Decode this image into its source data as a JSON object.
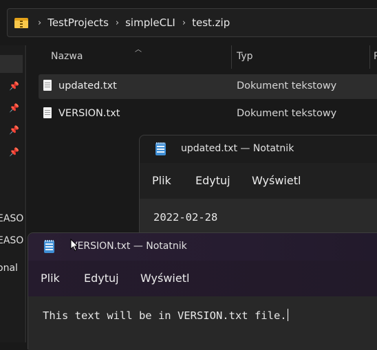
{
  "address_bar": {
    "crumbs": [
      "TestProjects",
      "simpleCLI",
      "test.zip"
    ]
  },
  "columns": {
    "name": "Nazwa",
    "type": "Typ",
    "extra": "R"
  },
  "files": [
    {
      "name": "updated.txt",
      "type": "Dokument tekstowy"
    },
    {
      "name": "VERSION.txt",
      "type": "Dokument tekstowy"
    }
  ],
  "sidebar": {
    "labels": [
      "EASO",
      "EASO",
      "onal"
    ]
  },
  "notepad_back": {
    "title": "updated.txt — Notatnik",
    "menu": [
      "Plik",
      "Edytuj",
      "Wyświetl"
    ],
    "content": "2022-02-28"
  },
  "notepad_front": {
    "title": "VERSION.txt — Notatnik",
    "menu": [
      "Plik",
      "Edytuj",
      "Wyświetl"
    ],
    "content": "This text will be in VERSION.txt file."
  }
}
